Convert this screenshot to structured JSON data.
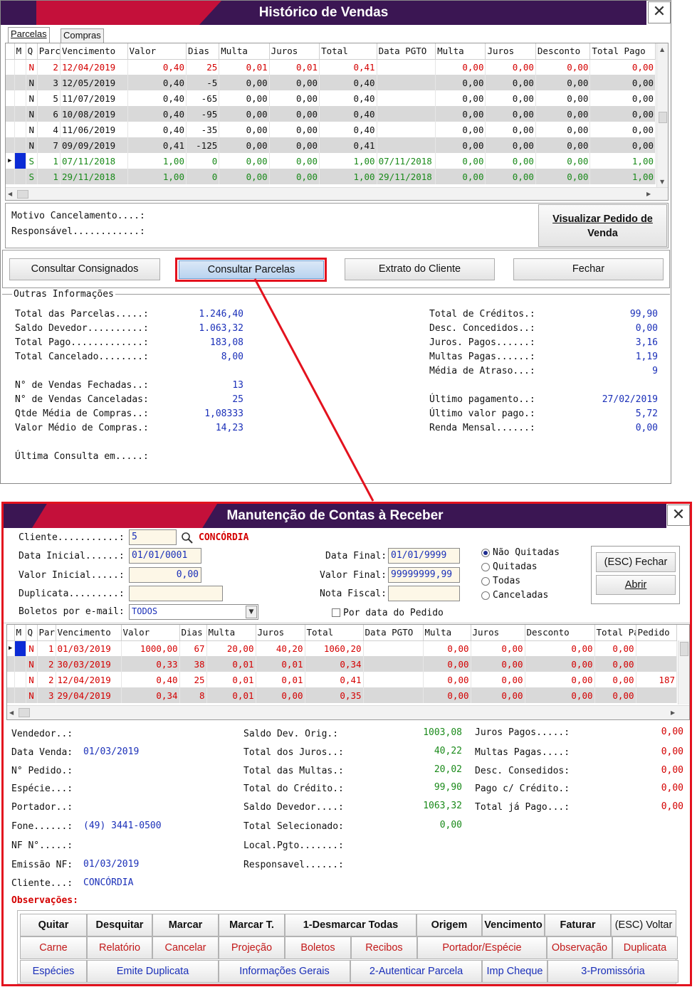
{
  "window1": {
    "title": "Histórico de Vendas",
    "tabs": [
      "Parcelas",
      "Compras"
    ],
    "columns": [
      "M",
      "Q",
      "Parc",
      "Vencimento",
      "Valor",
      "Dias",
      "Multa",
      "Juros",
      "Total",
      "Data PGTO",
      "Multa",
      "Juros",
      "Desconto",
      "Total Pago"
    ],
    "rows": [
      {
        "m": "",
        "q": "N",
        "parc": "2",
        "venc": "12/04/2019",
        "valor": "0,40",
        "dias": "25",
        "multa": "0,01",
        "juros": "0,01",
        "total": "0,41",
        "data_pgto": "",
        "multa2": "0,00",
        "juros2": "0,00",
        "desconto": "0,00",
        "total_pago": "0,00",
        "color": "red",
        "alt": false
      },
      {
        "m": "",
        "q": "N",
        "parc": "3",
        "venc": "12/05/2019",
        "valor": "0,40",
        "dias": "-5",
        "multa": "0,00",
        "juros": "0,00",
        "total": "0,40",
        "data_pgto": "",
        "multa2": "0,00",
        "juros2": "0,00",
        "desconto": "0,00",
        "total_pago": "0,00",
        "color": "blk",
        "alt": true
      },
      {
        "m": "",
        "q": "N",
        "parc": "5",
        "venc": "11/07/2019",
        "valor": "0,40",
        "dias": "-65",
        "multa": "0,00",
        "juros": "0,00",
        "total": "0,40",
        "data_pgto": "",
        "multa2": "0,00",
        "juros2": "0,00",
        "desconto": "0,00",
        "total_pago": "0,00",
        "color": "blk",
        "alt": false
      },
      {
        "m": "",
        "q": "N",
        "parc": "6",
        "venc": "10/08/2019",
        "valor": "0,40",
        "dias": "-95",
        "multa": "0,00",
        "juros": "0,00",
        "total": "0,40",
        "data_pgto": "",
        "multa2": "0,00",
        "juros2": "0,00",
        "desconto": "0,00",
        "total_pago": "0,00",
        "color": "blk",
        "alt": true
      },
      {
        "m": "",
        "q": "N",
        "parc": "4",
        "venc": "11/06/2019",
        "valor": "0,40",
        "dias": "-35",
        "multa": "0,00",
        "juros": "0,00",
        "total": "0,40",
        "data_pgto": "",
        "multa2": "0,00",
        "juros2": "0,00",
        "desconto": "0,00",
        "total_pago": "0,00",
        "color": "blk",
        "alt": false
      },
      {
        "m": "",
        "q": "N",
        "parc": "7",
        "venc": "09/09/2019",
        "valor": "0,41",
        "dias": "-125",
        "multa": "0,00",
        "juros": "0,00",
        "total": "0,41",
        "data_pgto": "",
        "multa2": "0,00",
        "juros2": "0,00",
        "desconto": "0,00",
        "total_pago": "0,00",
        "color": "blk",
        "alt": true
      },
      {
        "m": "",
        "q": "S",
        "parc": "1",
        "venc": "07/11/2018",
        "valor": "1,00",
        "dias": "0",
        "multa": "0,00",
        "juros": "0,00",
        "total": "1,00",
        "data_pgto": "07/11/2018",
        "multa2": "0,00",
        "juros2": "0,00",
        "desconto": "0,00",
        "total_pago": "1,00",
        "color": "grn",
        "alt": false,
        "selected": true
      },
      {
        "m": "",
        "q": "S",
        "parc": "1",
        "venc": "29/11/2018",
        "valor": "1,00",
        "dias": "0",
        "multa": "0,00",
        "juros": "0,00",
        "total": "1,00",
        "data_pgto": "29/11/2018",
        "multa2": "0,00",
        "juros2": "0,00",
        "desconto": "0,00",
        "total_pago": "1,00",
        "color": "grn",
        "alt": true
      }
    ],
    "motivo_label": "Motivo Cancelamento....:",
    "responsavel_label": "Responsável............:",
    "visualizar_label_1": "Visualizar Pedido de",
    "visualizar_label_2": "Venda",
    "buttons": {
      "consultar_consignados": "Consultar Consignados",
      "consultar_parcelas": "Consultar Parcelas",
      "extrato_cliente": "Extrato do Cliente",
      "fechar": "Fechar"
    },
    "outras": {
      "legend": "Outras Informações",
      "left": [
        {
          "label": "Total das Parcelas.....:",
          "value": "1.246,40"
        },
        {
          "label": "Saldo Devedor..........:",
          "value": "1.063,32"
        },
        {
          "label": "Total Pago.............:",
          "value": "183,08"
        },
        {
          "label": "Total Cancelado........:",
          "value": "8,00"
        },
        {
          "label": "N° de Vendas Fechadas..:",
          "value": "13"
        },
        {
          "label": "N° de Vendas Canceladas:",
          "value": "25"
        },
        {
          "label": "Qtde Média de Compras..:",
          "value": "1,08333"
        },
        {
          "label": "Valor Médio de Compras.:",
          "value": "14,23"
        },
        {
          "label": "Última Consulta em.....:",
          "value": ""
        }
      ],
      "right": [
        {
          "label": "Total de Créditos.:",
          "value": "99,90"
        },
        {
          "label": "Desc. Concedidos..:",
          "value": "0,00"
        },
        {
          "label": "Juros. Pagos......:",
          "value": "3,16"
        },
        {
          "label": "Multas Pagas......:",
          "value": "1,19"
        },
        {
          "label": "Média de Atraso...:",
          "value": "9"
        },
        {
          "label": "Último pagamento..:",
          "value": "27/02/2019"
        },
        {
          "label": "Último valor pago.:",
          "value": "5,72"
        },
        {
          "label": "Renda Mensal......:",
          "value": "0,00"
        }
      ]
    }
  },
  "window2": {
    "title": "Manutenção de Contas à Receber",
    "filters": {
      "cliente_label": "Cliente...........:",
      "cliente_value": "5",
      "cliente_name": "CONCÓRDIA",
      "data_inicial_label": "Data Inicial......:",
      "data_inicial_value": "01/01/0001",
      "valor_inicial_label": "Valor Inicial.....:",
      "valor_inicial_value": "0,00",
      "duplicata_label": "Duplicata.........:",
      "duplicata_value": "",
      "boletos_label": "Boletos por e-mail:",
      "boletos_value": "TODOS",
      "data_final_label": "Data Final:",
      "data_final_value": "01/01/9999",
      "valor_final_label": "Valor Final:",
      "valor_final_value": "99999999,99",
      "nota_fiscal_label": "Nota Fiscal:",
      "nota_fiscal_value": "",
      "por_data_label": "Por data do Pedido",
      "radios": [
        "Não Quitadas",
        "Quitadas",
        "Todas",
        "Canceladas"
      ],
      "radio_selected": 0,
      "fechar_label": "(ESC) Fechar",
      "abrir_label": "Abrir"
    },
    "columns": [
      "M",
      "Q",
      "Par",
      "Vencimento",
      "Valor",
      "Dias",
      "Multa",
      "Juros",
      "Total",
      "Data PGTO",
      "Multa",
      "Juros",
      "Desconto",
      "Total Pago",
      "Pedido"
    ],
    "rows": [
      {
        "q": "N",
        "par": "1",
        "venc": "01/03/2019",
        "valor": "1000,00",
        "dias": "67",
        "multa": "20,00",
        "juros": "40,20",
        "total": "1060,20",
        "data_pgto": "",
        "multa2": "0,00",
        "juros2": "0,00",
        "desconto": "0,00",
        "total_pago": "0,00",
        "pedido": "",
        "alt": false,
        "selected": true
      },
      {
        "q": "N",
        "par": "2",
        "venc": "30/03/2019",
        "valor": "0,33",
        "dias": "38",
        "multa": "0,01",
        "juros": "0,01",
        "total": "0,34",
        "data_pgto": "",
        "multa2": "0,00",
        "juros2": "0,00",
        "desconto": "0,00",
        "total_pago": "0,00",
        "pedido": "",
        "alt": true
      },
      {
        "q": "N",
        "par": "2",
        "venc": "12/04/2019",
        "valor": "0,40",
        "dias": "25",
        "multa": "0,01",
        "juros": "0,01",
        "total": "0,41",
        "data_pgto": "",
        "multa2": "0,00",
        "juros2": "0,00",
        "desconto": "0,00",
        "total_pago": "0,00",
        "pedido": "187",
        "alt": false
      },
      {
        "q": "N",
        "par": "3",
        "venc": "29/04/2019",
        "valor": "0,34",
        "dias": "8",
        "multa": "0,01",
        "juros": "0,00",
        "total": "0,35",
        "data_pgto": "",
        "multa2": "0,00",
        "juros2": "0,00",
        "desconto": "0,00",
        "total_pago": "0,00",
        "pedido": "",
        "alt": true
      }
    ],
    "details": {
      "col1": [
        {
          "label": "Vendedor..:",
          "value": ""
        },
        {
          "label": "Data Venda:",
          "value": "01/03/2019"
        },
        {
          "label": "N° Pedido.:",
          "value": ""
        },
        {
          "label": "Espécie...:",
          "value": ""
        },
        {
          "label": "Portador..:",
          "value": ""
        },
        {
          "label": "Fone......:",
          "value": "(49) 3441-0500"
        },
        {
          "label": "NF N°.....:",
          "value": ""
        },
        {
          "label": "Emissão NF:",
          "value": "01/03/2019"
        },
        {
          "label": "Cliente...:",
          "value": "CONCÓRDIA"
        }
      ],
      "observacoes_label": "Observações:",
      "col2": [
        {
          "label": "Saldo Dev. Orig.:",
          "value": "1003,08"
        },
        {
          "label": "Total dos Juros..:",
          "value": "40,22"
        },
        {
          "label": "Total das Multas.:",
          "value": "20,02"
        },
        {
          "label": "Total do Crédito.:",
          "value": "99,90"
        },
        {
          "label": "Saldo Devedor....:",
          "value": "1063,32"
        },
        {
          "label": "Total Selecionado:",
          "value": "0,00"
        },
        {
          "label": "Local.Pgto.......:",
          "value": ""
        },
        {
          "label": "Responsavel......:",
          "value": ""
        }
      ],
      "col3": [
        {
          "label": "Juros Pagos.....:",
          "value": "0,00"
        },
        {
          "label": "Multas Pagas....:",
          "value": "0,00"
        },
        {
          "label": "Desc. Consedidos:",
          "value": "0,00"
        },
        {
          "label": "Pago c/ Crédito.:",
          "value": "0,00"
        },
        {
          "label": "Total já Pago...:",
          "value": "0,00"
        }
      ]
    },
    "action_rows": [
      [
        "Quitar",
        "Desquitar",
        "Marcar",
        "Marcar T.",
        "1-Desmarcar Todas",
        "Origem",
        "Vencimento",
        "Faturar",
        "(ESC) Voltar"
      ],
      [
        "Carne",
        "Relatório",
        "Cancelar",
        "Projeção",
        "Boletos",
        "Recibos",
        "Portador/Espécie",
        "Observação",
        "Duplicata"
      ],
      [
        "Espécies",
        "Emite Duplicata",
        "Informações Gerais",
        "2-Autenticar Parcela",
        "Imp Cheque",
        "3-Promissória"
      ]
    ]
  }
}
